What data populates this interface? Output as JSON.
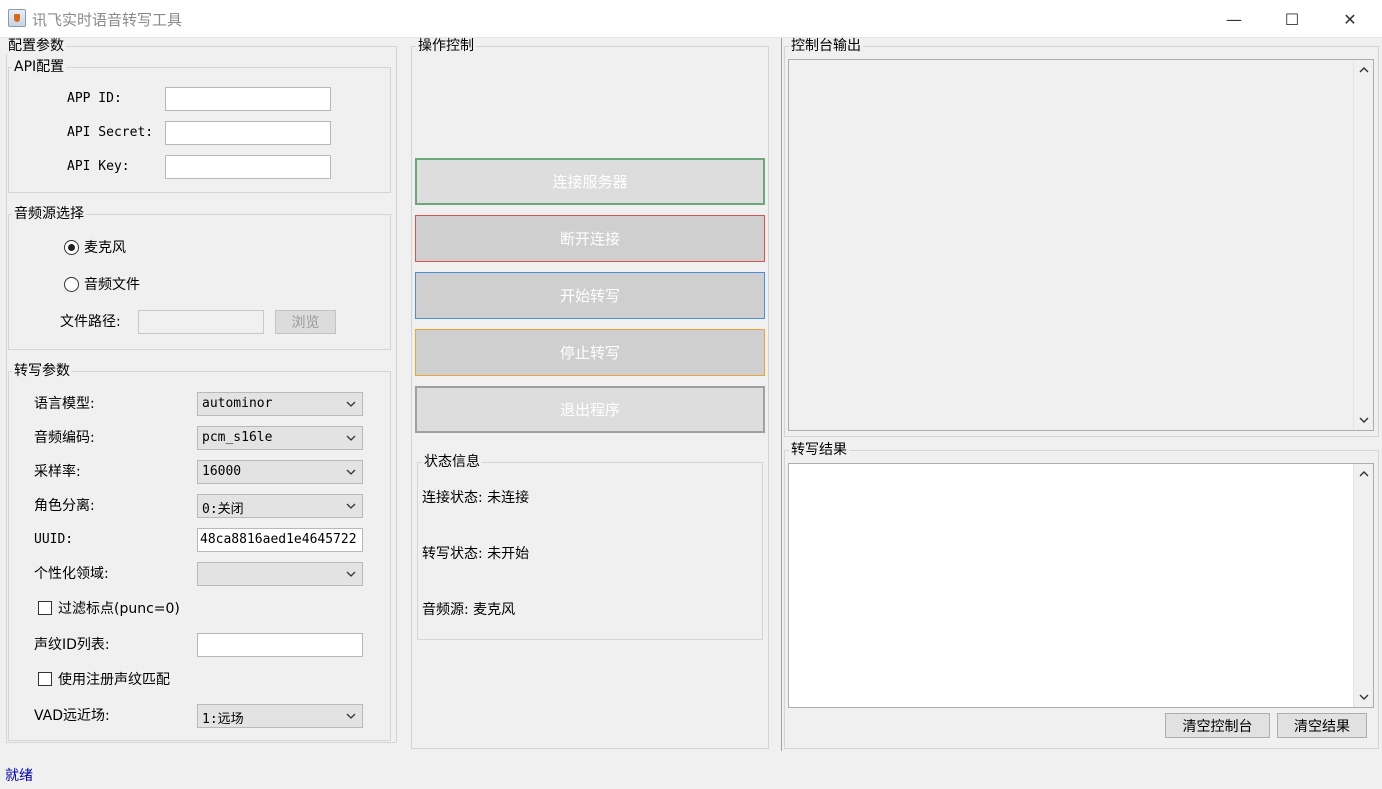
{
  "window": {
    "title": "讯飞实时语音转写工具",
    "controls": {
      "minimize": "—",
      "maximize": "☐",
      "close": "✕"
    }
  },
  "config_panel": {
    "title": "配置参数",
    "api": {
      "title": "API配置",
      "app_id_label": "APP ID:",
      "api_secret_label": "API Secret:",
      "api_key_label": "API Key:",
      "app_id_value": "",
      "api_secret_value": "",
      "api_key_value": ""
    },
    "audio_source": {
      "title": "音频源选择",
      "option_mic": "麦克风",
      "option_file": "音频文件",
      "selected": "麦克风",
      "file_path_label": "文件路径:",
      "file_path_value": "",
      "browse_label": "浏览"
    },
    "transcribe": {
      "title": "转写参数",
      "language_model_label": "语言模型:",
      "language_model_value": "autominor",
      "audio_encoding_label": "音频编码:",
      "audio_encoding_value": "pcm_s16le",
      "sample_rate_label": "采样率:",
      "sample_rate_value": "16000",
      "role_separation_label": "角色分离:",
      "role_separation_value": "0:关闭",
      "uuid_label": "UUID:",
      "uuid_value": "48ca8816aed1e4645722",
      "domain_label": "个性化领域:",
      "domain_value": "",
      "filter_punc_label": "过滤标点(punc=0)",
      "filter_punc_checked": false,
      "voiceprint_ids_label": "声纹ID列表:",
      "voiceprint_ids_value": "",
      "use_voiceprint_label": "使用注册声纹匹配",
      "use_voiceprint_checked": false,
      "vad_label": "VAD远近场:",
      "vad_value": "1:远场"
    }
  },
  "control_panel": {
    "title": "操作控制",
    "buttons": {
      "connect": "连接服务器",
      "disconnect": "断开连接",
      "start": "开始转写",
      "stop": "停止转写",
      "exit": "退出程序"
    },
    "status": {
      "title": "状态信息",
      "connection": "连接状态: 未连接",
      "transcription": "转写状态: 未开始",
      "audio_source": "音频源: 麦克风"
    }
  },
  "output_panel": {
    "console_title": "控制台输出",
    "console_text": "",
    "result_title": "转写结果",
    "result_text": "",
    "clear_console_label": "清空控制台",
    "clear_result_label": "清空结果"
  },
  "statusbar": {
    "text": "就绪"
  },
  "colors": {
    "connect_border": "#6aa87a",
    "disconnect_border": "#d9534f",
    "start_border": "#4a90d9",
    "stop_border": "#e8a53a",
    "exit_border": "#a0a0a0",
    "statusbar_text": "#0000aa"
  }
}
